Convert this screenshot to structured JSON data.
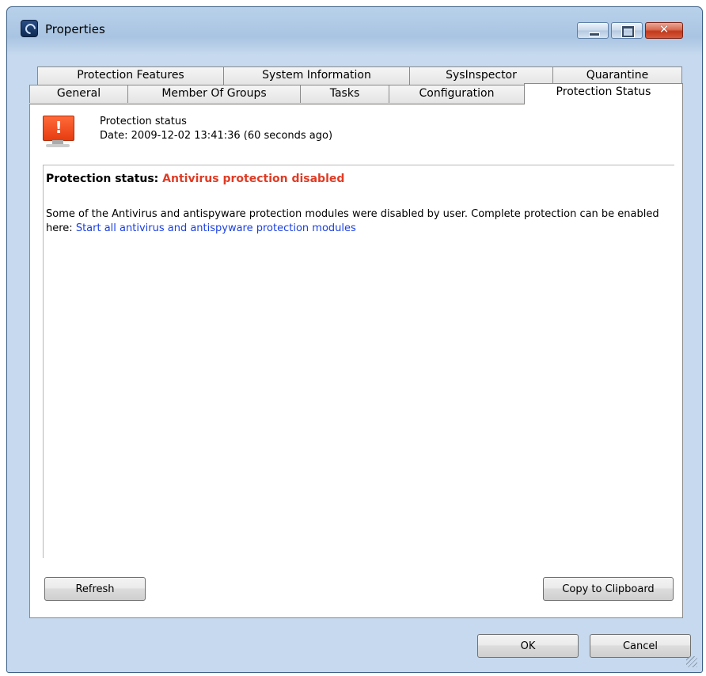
{
  "window": {
    "title": "Properties",
    "controls": {
      "minimize": "–",
      "maximize": "□",
      "close": "✕"
    }
  },
  "tabs": {
    "back_row": [
      "Protection Features",
      "System Information",
      "SysInspector",
      "Quarantine"
    ],
    "front_row": [
      "General",
      "Member Of Groups",
      "Tasks",
      "Configuration",
      "Protection Status"
    ],
    "active": "Protection Status"
  },
  "header": {
    "title": "Protection status",
    "date": "Date: 2009-12-02 13:41:36 (60 seconds ago)"
  },
  "status": {
    "label": "Protection status: ",
    "value": "Antivirus protection disabled",
    "value_color": "#e03b24"
  },
  "description": {
    "text": "Some of the Antivirus and antispyware protection modules were disabled by user. Complete protection can be enabled here: ",
    "link": "Start all antivirus and antispyware protection modules"
  },
  "buttons": {
    "refresh": "Refresh",
    "copy": "Copy to Clipboard",
    "ok": "OK",
    "cancel": "Cancel"
  },
  "icons": {
    "app": "remote-admin-icon",
    "status": "monitor-warning-icon"
  }
}
